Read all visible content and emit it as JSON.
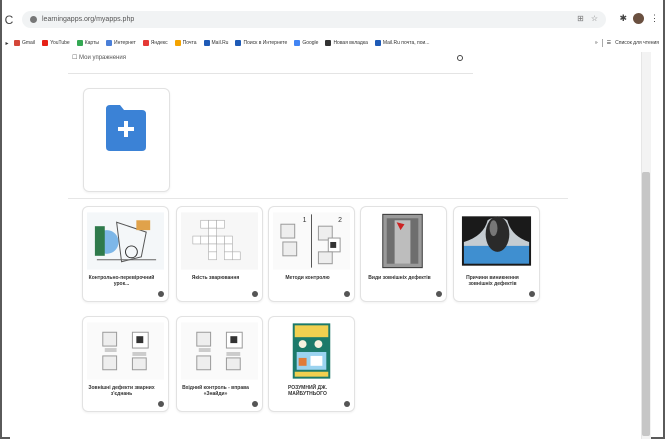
{
  "browser": {
    "url": "learningapps.org/myapps.php",
    "bookmarks": [
      {
        "label": "Gmail",
        "color": "#d44638"
      },
      {
        "label": "YouTube",
        "color": "#e62117"
      },
      {
        "label": "Карты",
        "color": "#34a853"
      },
      {
        "label": "Интернет",
        "color": "#4a7fd8"
      },
      {
        "label": "Яндекс",
        "color": "#e53935"
      },
      {
        "label": "Почта",
        "color": "#f4a300"
      },
      {
        "label": "Mail.Ru",
        "color": "#1e5ab6"
      },
      {
        "label": "Поиск в Интернете",
        "color": "#1e5ab6"
      },
      {
        "label": "Google",
        "color": "#4285f4"
      },
      {
        "label": "Новая вкладка",
        "color": "#333333"
      },
      {
        "label": "Mail.Ru почта, пои...",
        "color": "#1e5ab6"
      }
    ],
    "bookmarks_more": "»",
    "reading_list": "Список для чтения"
  },
  "page": {
    "search_label": "☐ Мои упражнения",
    "add_icon": "plus-folder",
    "accent": "#3b82d6",
    "apps": [
      {
        "title": "Контрольно-перевірочний урок...",
        "thumb": "blueprint"
      },
      {
        "title": "Якість зварювання",
        "thumb": "crossword"
      },
      {
        "title": "Методи контролю",
        "thumb": "pairs"
      },
      {
        "title": "Види зовнішніх дефектів",
        "thumb": "photo-defect"
      },
      {
        "title": "Причини виникнення зовнішніх дефектів",
        "thumb": "photo-weld"
      },
      {
        "title": "Зовнішні дефекти зварних з'єднань",
        "thumb": "cards"
      },
      {
        "title": "Вхідний контроль - вправа «Знайди»",
        "thumb": "cards"
      },
      {
        "title": "РОЗУМНИЙ ДЖ. МАЙБУТНЬОГО",
        "thumb": "poster"
      }
    ]
  }
}
